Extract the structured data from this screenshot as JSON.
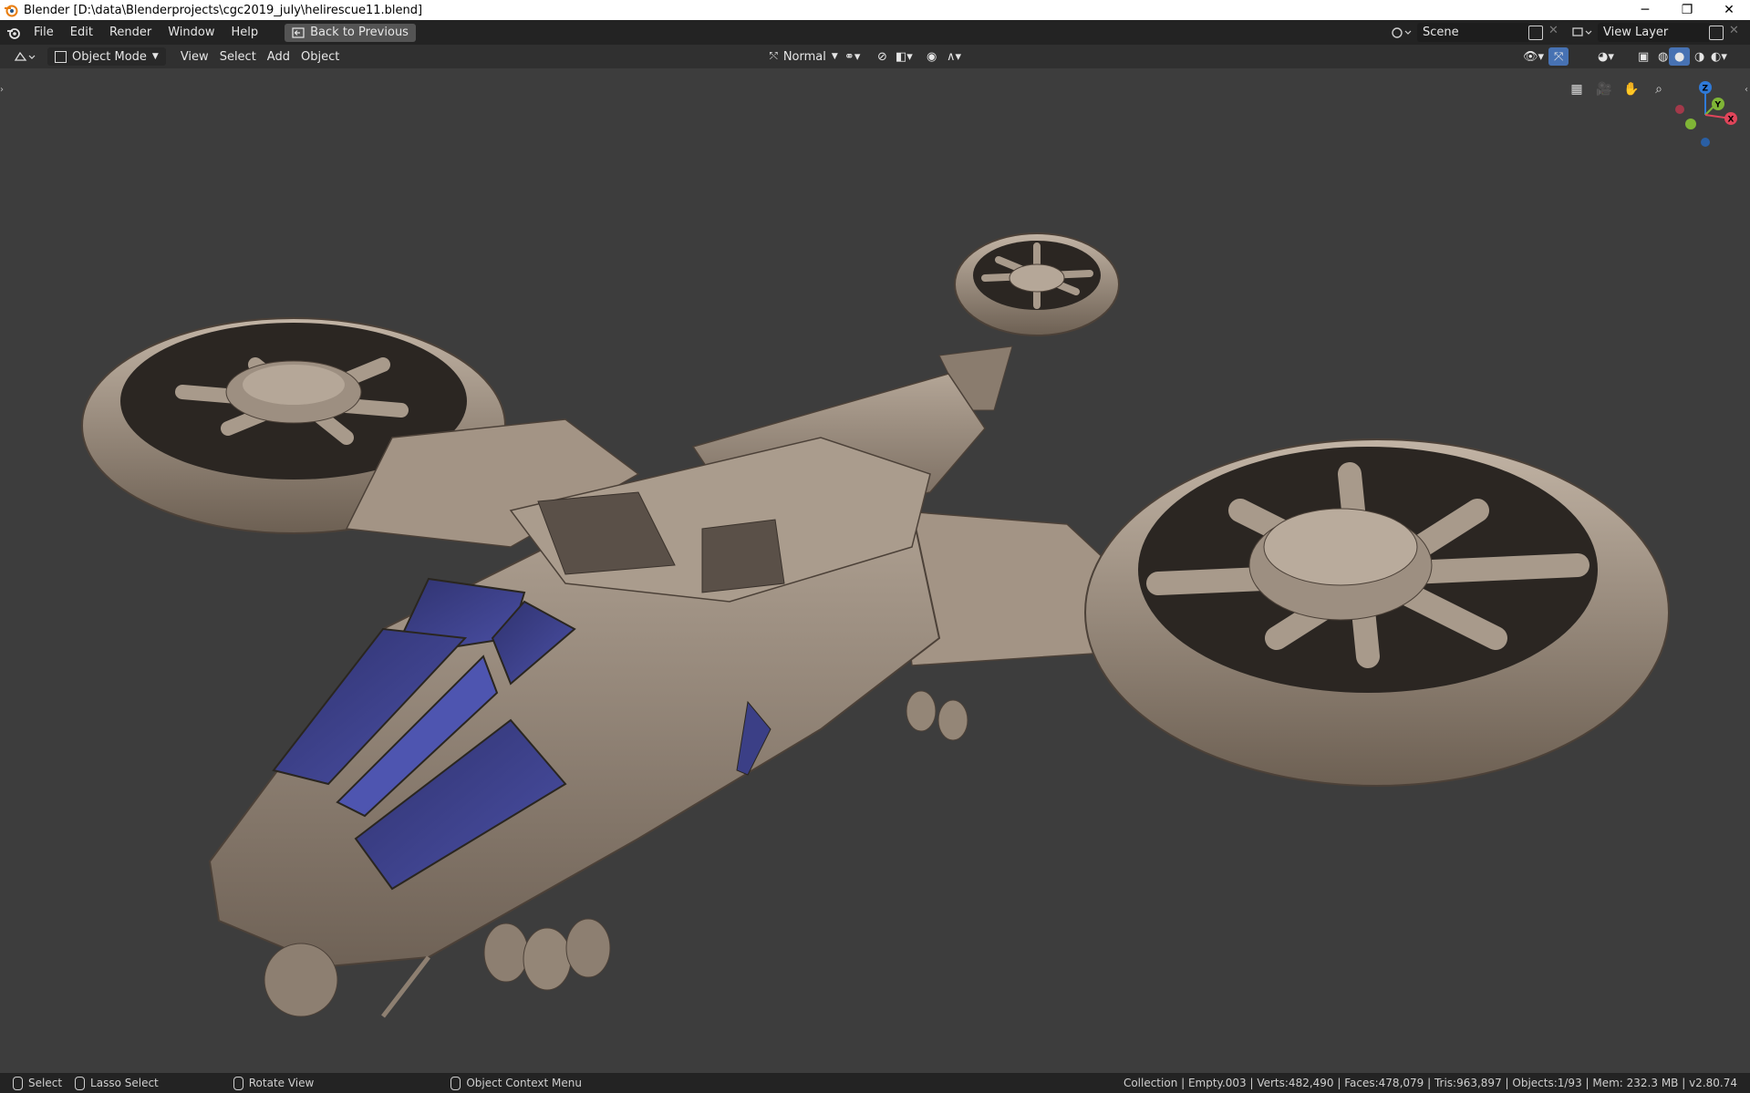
{
  "window": {
    "title": "Blender [D:\\data\\Blenderprojects\\cgc2019_july\\helirescue11.blend]",
    "minimize": "─",
    "maximize": "❐",
    "close": "✕"
  },
  "topbar": {
    "menus": [
      "File",
      "Edit",
      "Render",
      "Window",
      "Help"
    ],
    "back_button": "Back to Previous",
    "scene_name": "Scene",
    "view_layer_name": "View Layer"
  },
  "viewport_header": {
    "mode": "Object Mode",
    "menus": [
      "View",
      "Select",
      "Add",
      "Object"
    ],
    "orientation": "Normal"
  },
  "gizmo": {
    "x": "X",
    "y": "Y",
    "z": "Z"
  },
  "statusbar": {
    "hints": [
      "Select",
      "Lasso Select",
      "Rotate View",
      "Object Context Menu"
    ],
    "stats": "Collection | Empty.003 | Verts:482,490 | Faces:478,079 | Tris:963,897 | Objects:1/93 | Mem: 232.3 MB | v2.80.74"
  },
  "colors": {
    "background": "#3d3d3d",
    "model": "#9c8e80",
    "glass": "#3b3f86",
    "accent": "#4772b3"
  }
}
